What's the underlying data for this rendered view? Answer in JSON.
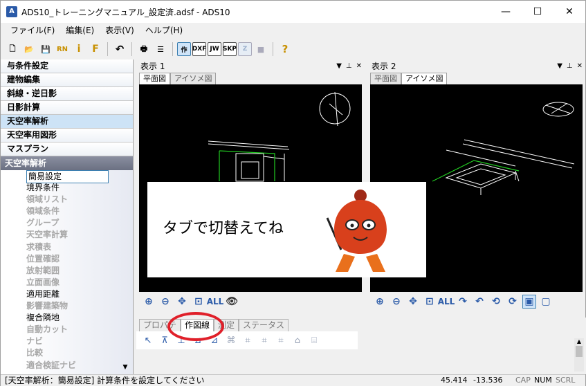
{
  "window": {
    "title": "ADS10_トレーニングマニュアル_設定済.adsf - ADS10",
    "app_icon": "A",
    "minimize": "—",
    "maximize": "☐",
    "close": "✕"
  },
  "menu": [
    "ファイル(F)",
    "編集(E)",
    "表示(V)",
    "ヘルプ(H)"
  ],
  "toolbar": {
    "items": [
      {
        "name": "new-file-icon",
        "glyph": "🗋"
      },
      {
        "name": "open-folder-icon",
        "glyph": "📂"
      },
      {
        "name": "save-icon",
        "glyph": "💾"
      },
      {
        "name": "rn-icon",
        "glyph": "RN"
      },
      {
        "name": "info-icon",
        "glyph": "i"
      },
      {
        "name": "f-icon",
        "glyph": "F"
      },
      {
        "name": "undo-icon",
        "glyph": "↶"
      },
      {
        "name": "print-icon",
        "glyph": "🖶"
      },
      {
        "name": "list-icon",
        "glyph": "☰"
      }
    ],
    "boxes": [
      "作",
      "DXF",
      "JW",
      "SKP",
      "Z",
      "■",
      "?"
    ]
  },
  "nav": {
    "items": [
      "与条件設定",
      "建物編集",
      "斜線・逆日影",
      "日影計算",
      "天空率解析",
      "天空率用図形",
      "マスプラン"
    ],
    "active_index": 4,
    "section_title": "天空率解析",
    "tree": [
      {
        "label": "簡易設定",
        "state": "selected"
      },
      {
        "label": "境界条件",
        "state": "normal"
      },
      {
        "label": "領域リスト",
        "state": "disabled"
      },
      {
        "label": "領域条件",
        "state": "disabled"
      },
      {
        "label": "グループ",
        "state": "disabled"
      },
      {
        "label": "天空率計算",
        "state": "disabled"
      },
      {
        "label": "求積表",
        "state": "disabled"
      },
      {
        "label": "位置確認",
        "state": "disabled"
      },
      {
        "label": "放射範囲",
        "state": "disabled"
      },
      {
        "label": "立面画像",
        "state": "disabled"
      },
      {
        "label": "適用距離",
        "state": "normal"
      },
      {
        "label": "影響建築物",
        "state": "disabled"
      },
      {
        "label": "複合隣地",
        "state": "normal"
      },
      {
        "label": "自動カット",
        "state": "disabled"
      },
      {
        "label": "ナビ",
        "state": "disabled"
      },
      {
        "label": "比較",
        "state": "disabled"
      },
      {
        "label": "適合検証ナビ",
        "state": "disabled"
      }
    ]
  },
  "view1": {
    "title": "表示 1",
    "tabs": [
      "平面図",
      "アイソメ図"
    ],
    "active_tab": 0,
    "ctrl_dropdown": "▼",
    "ctrl_pin": "⊥",
    "ctrl_close": "✕"
  },
  "view2": {
    "title": "表示 2",
    "tabs": [
      "平面図",
      "アイソメ図"
    ],
    "active_tab": 1,
    "ctrl_dropdown": "▼",
    "ctrl_pin": "⊥",
    "ctrl_close": "✕"
  },
  "view1_tools": [
    "⊕",
    "⊖",
    "✥",
    "⊡",
    "ALL",
    "👁"
  ],
  "view2_tools": [
    "⊕",
    "⊖",
    "✥",
    "⊡",
    "ALL",
    "↷",
    "↶",
    "⟲",
    "⟳",
    "▣",
    "▢"
  ],
  "bottom": {
    "tabs": [
      "プロパテ",
      "作図線",
      "測定",
      "ステータス"
    ],
    "active_tab": 1,
    "tools": [
      "↖",
      "⊼",
      "⊥",
      "⊿",
      "⊿",
      "⌘",
      "⌗",
      "⌗",
      "⌗",
      "⌂",
      "⌸"
    ]
  },
  "overlay": {
    "text": "タブで切替えてね"
  },
  "status": {
    "message": "[天空率解析：簡易設定] 計算条件を設定してください",
    "x": "45.414",
    "y": "-13.536",
    "cap": "CAP",
    "num": "NUM",
    "scrl": "SCRL"
  },
  "colors": {
    "accent": "#2a5aa8",
    "highlight": "#e0202a",
    "canvas_bg": "#000000",
    "lines": "#ffffff",
    "site_outline": "#22cc22"
  }
}
